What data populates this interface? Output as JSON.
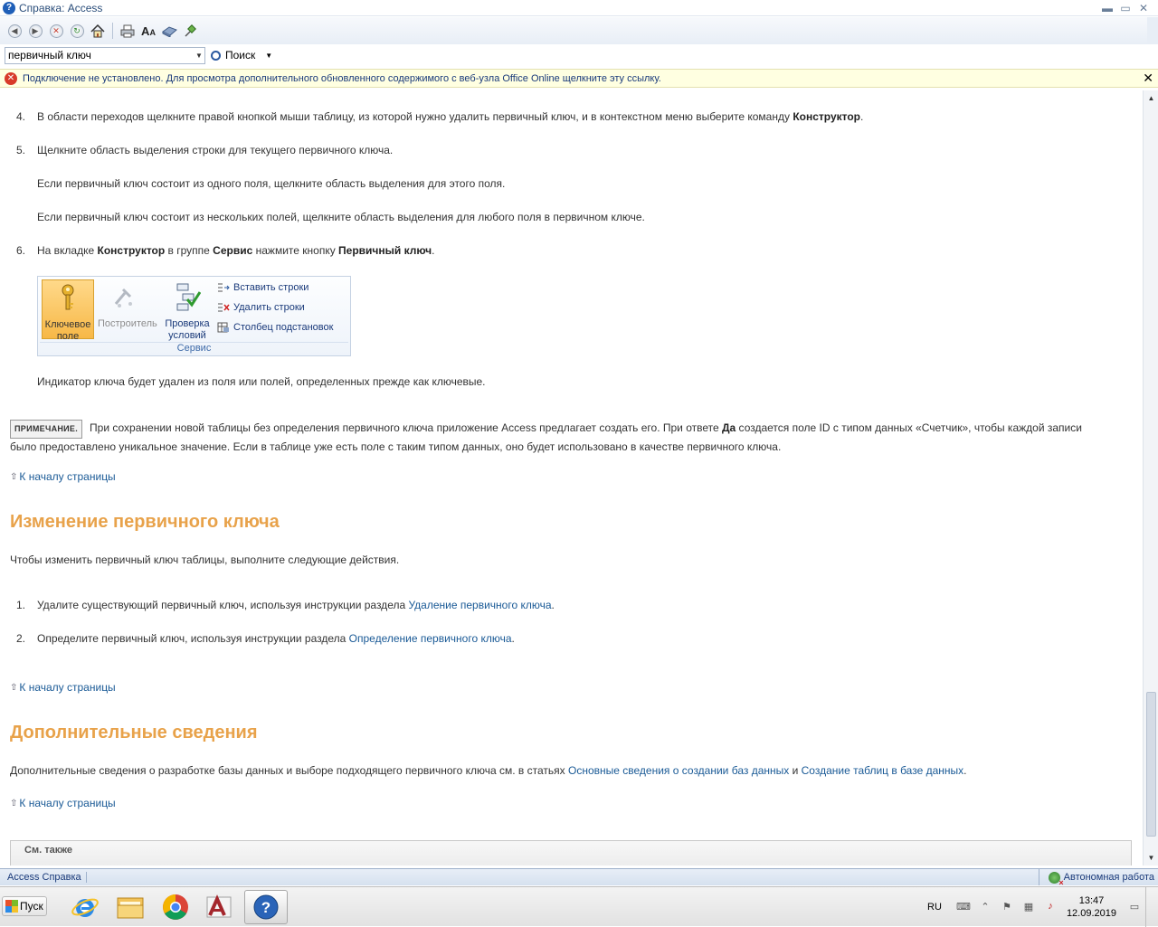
{
  "window": {
    "title": "Справка: Access"
  },
  "search": {
    "value": "первичный ключ",
    "button_label": "Поиск"
  },
  "infobar": {
    "text": "Подключение не установлено. Для просмотра дополнительного обновленного содержимого с веб-узла Office Online щелкните эту ссылку."
  },
  "content": {
    "steps_a": [
      {
        "num": "4.",
        "pre": "В области переходов щелкните правой кнопкой мыши таблицу, из которой нужно удалить первичный ключ, и в контекстном меню выберите команду ",
        "bold": "Конструктор",
        "post": "."
      },
      {
        "num": "5.",
        "text": "Щелкните область выделения строки для текущего первичного ключа."
      },
      {
        "num": "6.",
        "pre": "На вкладке ",
        "bold1": "Конструктор",
        "mid1": " в группе ",
        "bold2": "Сервис",
        "mid2": " нажмите кнопку ",
        "bold3": "Первичный ключ",
        "post": "."
      }
    ],
    "step5_para1": "Если первичный ключ состоит из одного поля, щелкните область выделения для этого поля.",
    "step5_para2": "Если первичный ключ состоит из нескольких полей, щелкните область выделения для любого поля в первичном ключе.",
    "ribbon": {
      "key_label_1": "Ключевое",
      "key_label_2": "поле",
      "builder_label": "Построитель",
      "check_label_1": "Проверка",
      "check_label_2": "условий",
      "insert_rows": "Вставить строки",
      "delete_rows": "Удалить строки",
      "lookup_column": "Столбец  подстановок",
      "group_name": "Сервис"
    },
    "indicator_text": "Индикатор ключа будет удален из поля или полей, определенных прежде как ключевые.",
    "note": {
      "tag": "ПРИМЕЧАНИЕ.",
      "pre": "При сохранении новой таблицы без определения первичного ключа приложение Access предлагает создать его. При ответе ",
      "bold": "Да",
      "post": " создается поле ID с типом данных «Счетчик», чтобы каждой записи",
      "line2": "было предоставлено уникальное значение. Если в таблице уже есть поле с таким типом данных, оно будет использовано в качестве первичного ключа."
    },
    "to_top": "К началу страницы",
    "section_change": {
      "heading": "Изменение первичного ключа",
      "intro": "Чтобы изменить первичный ключ таблицы, выполните следующие действия.",
      "step1_num": "1.",
      "step1_pre": "Удалите существующий первичный ключ, используя инструкции раздела ",
      "step1_link": "Удаление первичного ключа",
      "step1_post": ".",
      "step2_num": "2.",
      "step2_pre": "Определите первичный ключ, используя инструкции раздела ",
      "step2_link": "Определение первичного ключа",
      "step2_post": "."
    },
    "section_more": {
      "heading": "Дополнительные сведения",
      "pre": "Дополнительные сведения о разработке базы данных и выборе подходящего первичного ключа см. в статьях ",
      "link1": "Основные сведения о создании баз данных",
      "mid": " и ",
      "link2": "Создание таблиц в базе данных",
      "post": "."
    },
    "see_also": "См. также"
  },
  "statusbar": {
    "left": "Access Справка",
    "right": "Автономная работа"
  },
  "taskbar": {
    "start_label": "Пуск",
    "lang": "RU",
    "time": "13:47",
    "date": "12.09.2019"
  },
  "colors": {
    "heading": "#e8a24a",
    "link": "#1a5a96",
    "infobar_bg": "#ffffe1"
  }
}
